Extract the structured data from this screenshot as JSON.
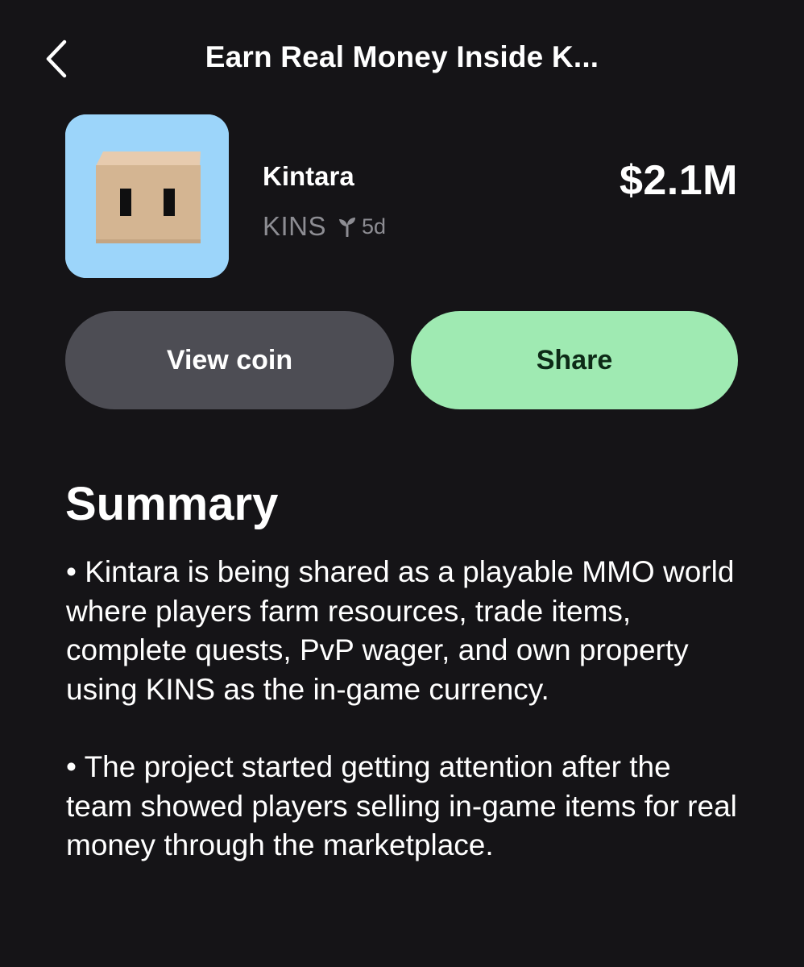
{
  "header": {
    "title": "Earn Real Money Inside K...",
    "back_icon": "chevron-left-icon"
  },
  "coin": {
    "name": "Kintara",
    "ticker": "KINS",
    "age": "5d",
    "age_icon": "sprout-icon",
    "market_cap": "$2.1M",
    "avatar_bg": "#9cd5fa"
  },
  "actions": {
    "view_coin_label": "View coin",
    "share_label": "Share"
  },
  "summary": {
    "heading": "Summary",
    "bullets": [
      "• Kintara is being shared as a playable MMO world where players farm resources, trade items, complete quests, PvP wager, and own property using KINS as the in-game currency.",
      "• The project started getting attention after the team showed players selling in-game items for real money through the marketplace."
    ]
  },
  "colors": {
    "background": "#151417",
    "secondary_button": "#4d4d54",
    "accent_button": "#9feab2",
    "muted_text": "#8d8d93"
  }
}
